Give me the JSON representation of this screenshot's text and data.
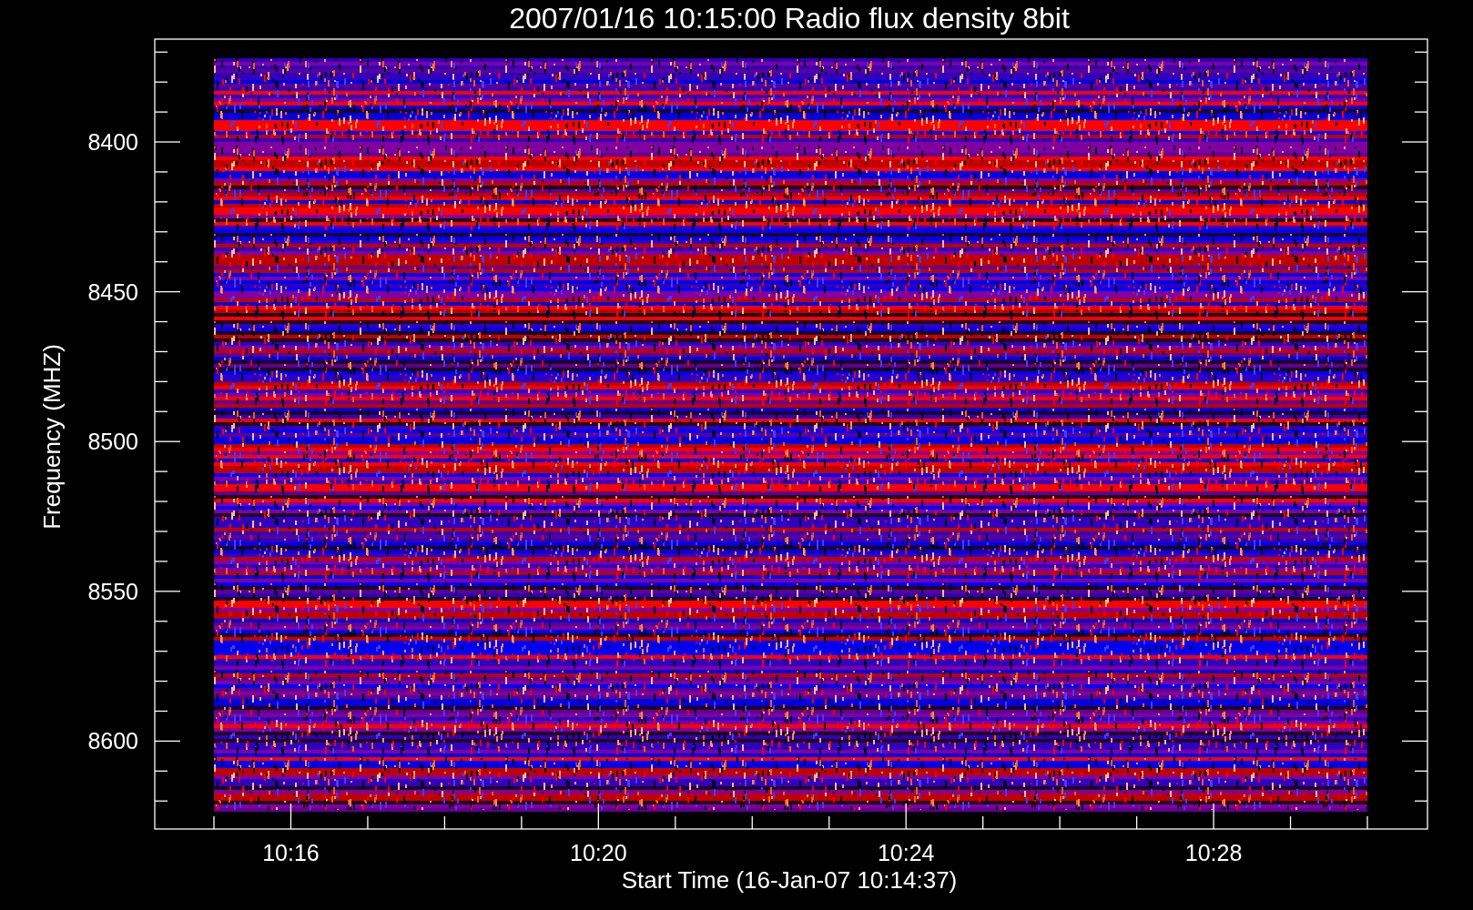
{
  "title": "2007/01/16 10:15:00 Radio flux density 8bit",
  "y_axis": {
    "label": "Frequency (MHZ)",
    "ticks": [
      "8400",
      "8450",
      "8500",
      "8550",
      "8600"
    ]
  },
  "x_axis": {
    "label": "Start Time (16-Jan-07 10:14:37)",
    "ticks": [
      "10:16",
      "10:20",
      "10:24",
      "10:28"
    ]
  }
}
